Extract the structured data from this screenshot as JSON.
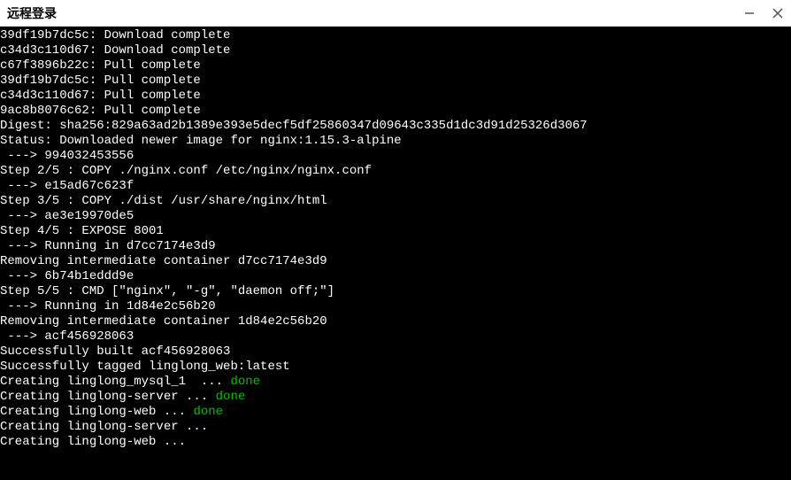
{
  "window": {
    "title": "远程登录"
  },
  "terminal": {
    "lines": [
      [
        {
          "t": "39df19b7dc5c: Download complete",
          "c": "white"
        }
      ],
      [
        {
          "t": "c34d3c110d67: Download complete",
          "c": "white"
        }
      ],
      [
        {
          "t": "c67f3896b22c: Pull complete",
          "c": "white"
        }
      ],
      [
        {
          "t": "39df19b7dc5c: Pull complete",
          "c": "white"
        }
      ],
      [
        {
          "t": "c34d3c110d67: Pull complete",
          "c": "white"
        }
      ],
      [
        {
          "t": "9ac8b8076c62: Pull complete",
          "c": "white"
        }
      ],
      [
        {
          "t": "Digest: sha256:829a63ad2b1389e393e5decf5df25860347d09643c335d1dc3d91d25326d3067",
          "c": "white"
        }
      ],
      [
        {
          "t": "Status: Downloaded newer image for nginx:1.15.3-alpine",
          "c": "white"
        }
      ],
      [
        {
          "t": " ---> 994032453556",
          "c": "white"
        }
      ],
      [
        {
          "t": "Step 2/5 : COPY ./nginx.conf /etc/nginx/nginx.conf",
          "c": "white"
        }
      ],
      [
        {
          "t": " ---> e15ad67c623f",
          "c": "white"
        }
      ],
      [
        {
          "t": "Step 3/5 : COPY ./dist /usr/share/nginx/html",
          "c": "white"
        }
      ],
      [
        {
          "t": " ---> ae3e19970de5",
          "c": "white"
        }
      ],
      [
        {
          "t": "Step 4/5 : EXPOSE 8001",
          "c": "white"
        }
      ],
      [
        {
          "t": " ---> Running in d7cc7174e3d9",
          "c": "white"
        }
      ],
      [
        {
          "t": "Removing intermediate container d7cc7174e3d9",
          "c": "white"
        }
      ],
      [
        {
          "t": " ---> 6b74b1eddd9e",
          "c": "white"
        }
      ],
      [
        {
          "t": "Step 5/5 : CMD [\"nginx\", \"-g\", \"daemon off;\"]",
          "c": "white"
        }
      ],
      [
        {
          "t": " ---> Running in 1d84e2c56b20",
          "c": "white"
        }
      ],
      [
        {
          "t": "Removing intermediate container 1d84e2c56b20",
          "c": "white"
        }
      ],
      [
        {
          "t": " ---> acf456928063",
          "c": "white"
        }
      ],
      [
        {
          "t": "Successfully built acf456928063",
          "c": "white"
        }
      ],
      [
        {
          "t": "Successfully tagged linglong_web:latest",
          "c": "white"
        }
      ],
      [
        {
          "t": "Creating linglong_mysql_1  ... ",
          "c": "white"
        },
        {
          "t": "done",
          "c": "green"
        }
      ],
      [
        {
          "t": "Creating linglong-server ... ",
          "c": "white"
        },
        {
          "t": "done",
          "c": "green"
        }
      ],
      [
        {
          "t": "Creating linglong-web ... ",
          "c": "white"
        },
        {
          "t": "done",
          "c": "green"
        }
      ],
      [
        {
          "t": "Creating linglong-server ...",
          "c": "white"
        }
      ],
      [
        {
          "t": "Creating linglong-web ...",
          "c": "white"
        }
      ]
    ]
  }
}
